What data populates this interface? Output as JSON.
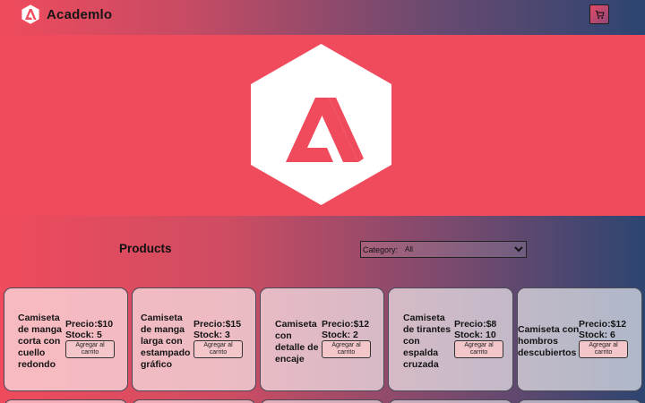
{
  "navbar": {
    "brand": "Academlo",
    "cart_icon": "cart-icon"
  },
  "hero": {
    "logo_icon": "academlo-logo"
  },
  "products_section": {
    "title": "Products",
    "category_label": "Category:",
    "category_selected": "All"
  },
  "products": [
    {
      "name": "Camiseta de manga corta con cuello redondo",
      "price": "Precio:$10",
      "stock": "Stock: 5",
      "button": "Agregar al carrito"
    },
    {
      "name": "Camiseta de manga larga con estampado gráfico",
      "price": "Precio:$15",
      "stock": "Stock: 3",
      "button": "Agregar al carrito"
    },
    {
      "name": "Camiseta con detalle de encaje",
      "price": "Precio:$12",
      "stock": "Stock: 2",
      "button": "Agregar al carrito"
    },
    {
      "name": "Camiseta de tirantes con espalda cruzada",
      "price": "Precio:$8",
      "stock": "Stock: 10",
      "button": "Agregar al carrito"
    },
    {
      "name": "Camiseta con hombros descubiertos",
      "price": "Precio:$12",
      "stock": "Stock: 6",
      "button": "Agregar al carrito"
    }
  ],
  "colors": {
    "brand_red": "#ef4b5c",
    "navy": "#2c4571",
    "button_bg": "#f3c6ca"
  }
}
